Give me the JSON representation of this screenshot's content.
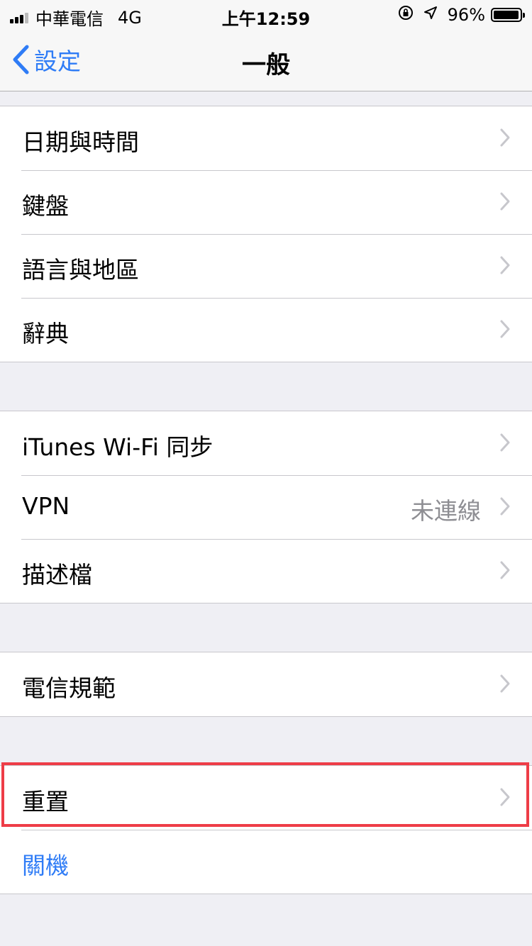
{
  "status_bar": {
    "carrier": "中華電信",
    "network": "4G",
    "time": "上午12:59",
    "battery": "96%",
    "battery_level": 0.96
  },
  "nav": {
    "back_label": "設定",
    "title": "一般"
  },
  "groups": [
    {
      "rows": [
        {
          "label": "日期與時間"
        },
        {
          "label": "鍵盤"
        },
        {
          "label": "語言與地區"
        },
        {
          "label": "辭典"
        }
      ]
    },
    {
      "rows": [
        {
          "label": "iTunes Wi-Fi 同步"
        },
        {
          "label": "VPN",
          "value": "未連線"
        },
        {
          "label": "描述檔"
        }
      ]
    },
    {
      "rows": [
        {
          "label": "電信規範"
        }
      ]
    },
    {
      "rows": [
        {
          "label": "重置"
        },
        {
          "label": "關機"
        }
      ]
    }
  ],
  "colors": {
    "accent": "#2f7cf6",
    "background": "#efeff4",
    "highlight": "#ee3d47",
    "secondary_text": "#8e8e93"
  },
  "icons": [
    "signal-icon",
    "orientation-lock-icon",
    "location-icon",
    "battery-icon",
    "back-chevron-icon",
    "chevron-right-icon"
  ]
}
